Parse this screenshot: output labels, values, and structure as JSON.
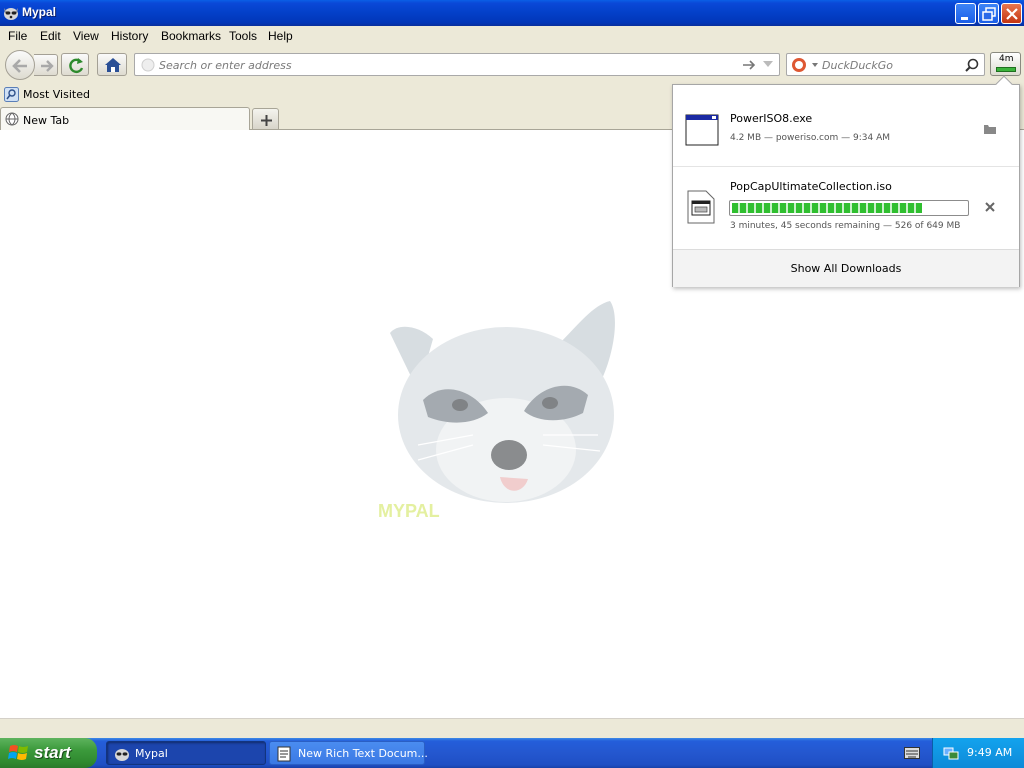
{
  "window": {
    "title": "Mypal"
  },
  "menu": {
    "items": [
      "File",
      "Edit",
      "View",
      "History",
      "Bookmarks",
      "Tools",
      "Help"
    ]
  },
  "navbar": {
    "url_placeholder": "Search or enter address",
    "search_placeholder": "DuckDuckGo",
    "download_time": "4m"
  },
  "bookmarks": {
    "items": [
      {
        "label": "Most Visited"
      }
    ]
  },
  "tabs": [
    {
      "label": "New Tab"
    }
  ],
  "downloads": {
    "items": [
      {
        "name": "PowerISO8.exe",
        "status": "4.2 MB — poweriso.com — 9:34 AM"
      },
      {
        "name": "PopCapUltimateCollection.iso",
        "status": "3 minutes, 45 seconds remaining — 526 of 649 MB",
        "progress": 0.81
      }
    ],
    "show_all": "Show All Downloads"
  },
  "taskbar": {
    "start": "start",
    "tasks": [
      {
        "label": "Mypal"
      },
      {
        "label": "New Rich Text Docum..."
      }
    ],
    "clock": "9:49 AM"
  },
  "colors": {
    "titlebar": "#0340c8",
    "taskbar": "#245edb",
    "start": "#3c9a3c",
    "progress": "#2fbf2f"
  }
}
